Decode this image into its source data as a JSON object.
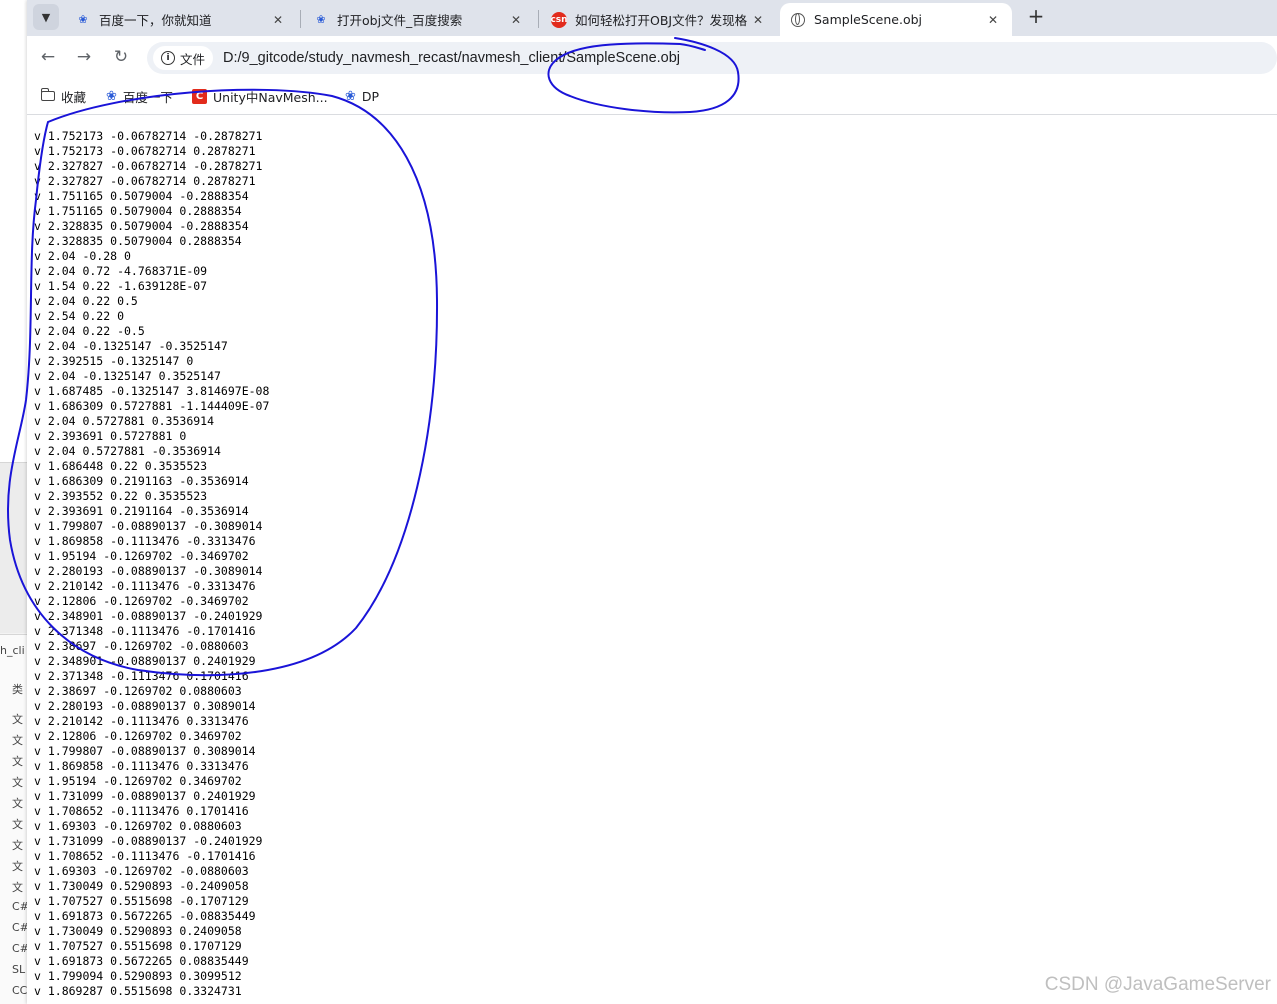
{
  "background_window": {
    "fragments": [
      "h_cli",
      "类",
      "文",
      "文",
      "文",
      "文",
      "文",
      "文",
      "文",
      "文",
      "文",
      "C#",
      "C#",
      "C#",
      "SL",
      "CC"
    ]
  },
  "tabs": [
    {
      "title": "百度一下，你就知道",
      "icon": "baidu-paw-icon"
    },
    {
      "title": "打开obj文件_百度搜索",
      "icon": "baidu-paw-icon"
    },
    {
      "title": "如何轻松打开OBJ文件？发现格",
      "icon": "csdn-icon",
      "icon_text": "csn"
    },
    {
      "title": "SampleScene.obj",
      "icon": "globe-icon",
      "active": true
    }
  ],
  "toolbar": {
    "site_chip_label": "文件",
    "url": "D:/9_gitcode/study_navmesh_recast/navmesh_client/SampleScene.obj"
  },
  "bookmarks": [
    {
      "label": "收藏",
      "icon": "folder-icon"
    },
    {
      "label": "百度一下",
      "icon": "baidu-paw-icon"
    },
    {
      "label": "Unity中NavMesh...",
      "icon": "csdn-icon",
      "icon_text": "C"
    },
    {
      "label": "DP",
      "icon": "baidu-paw-icon"
    }
  ],
  "file_lines": [
    "v 1.752173 -0.06782714 -0.2878271",
    "v 1.752173 -0.06782714 0.2878271",
    "v 2.327827 -0.06782714 -0.2878271",
    "v 2.327827 -0.06782714 0.2878271",
    "v 1.751165 0.5079004 -0.2888354",
    "v 1.751165 0.5079004 0.2888354",
    "v 2.328835 0.5079004 -0.2888354",
    "v 2.328835 0.5079004 0.2888354",
    "v 2.04 -0.28 0",
    "v 2.04 0.72 -4.768371E-09",
    "v 1.54 0.22 -1.639128E-07",
    "v 2.04 0.22 0.5",
    "v 2.54 0.22 0",
    "v 2.04 0.22 -0.5",
    "v 2.04 -0.1325147 -0.3525147",
    "v 2.392515 -0.1325147 0",
    "v 2.04 -0.1325147 0.3525147",
    "v 1.687485 -0.1325147 3.814697E-08",
    "v 1.686309 0.5727881 -1.144409E-07",
    "v 2.04 0.5727881 0.3536914",
    "v 2.393691 0.5727881 0",
    "v 2.04 0.5727881 -0.3536914",
    "v 1.686448 0.22 0.3535523",
    "v 1.686309 0.2191163 -0.3536914",
    "v 2.393552 0.22 0.3535523",
    "v 2.393691 0.2191164 -0.3536914",
    "v 1.799807 -0.08890137 -0.3089014",
    "v 1.869858 -0.1113476 -0.3313476",
    "v 1.95194 -0.1269702 -0.3469702",
    "v 2.280193 -0.08890137 -0.3089014",
    "v 2.210142 -0.1113476 -0.3313476",
    "v 2.12806 -0.1269702 -0.3469702",
    "v 2.348901 -0.08890137 -0.2401929",
    "v 2.371348 -0.1113476 -0.1701416",
    "v 2.38697 -0.1269702 -0.0880603",
    "v 2.348901 -0.08890137 0.2401929",
    "v 2.371348 -0.1113476 0.1701416",
    "v 2.38697 -0.1269702 0.0880603",
    "v 2.280193 -0.08890137 0.3089014",
    "v 2.210142 -0.1113476 0.3313476",
    "v 2.12806 -0.1269702 0.3469702",
    "v 1.799807 -0.08890137 0.3089014",
    "v 1.869858 -0.1113476 0.3313476",
    "v 1.95194 -0.1269702 0.3469702",
    "v 1.731099 -0.08890137 0.2401929",
    "v 1.708652 -0.1113476 0.1701416",
    "v 1.69303 -0.1269702 0.0880603",
    "v 1.731099 -0.08890137 -0.2401929",
    "v 1.708652 -0.1113476 -0.1701416",
    "v 1.69303 -0.1269702 -0.0880603",
    "v 1.730049 0.5290893 -0.2409058",
    "v 1.707527 0.5515698 -0.1707129",
    "v 1.691873 0.5672265 -0.08835449",
    "v 1.730049 0.5290893 0.2409058",
    "v 1.707527 0.5515698 0.1707129",
    "v 1.691873 0.5672265 0.08835449",
    "v 1.799094 0.5290893 0.3099512",
    "v 1.869287 0.5515698 0.3324731"
  ],
  "watermark": "CSDN @JavaGameServer",
  "annotation_color": "#1a14d8"
}
